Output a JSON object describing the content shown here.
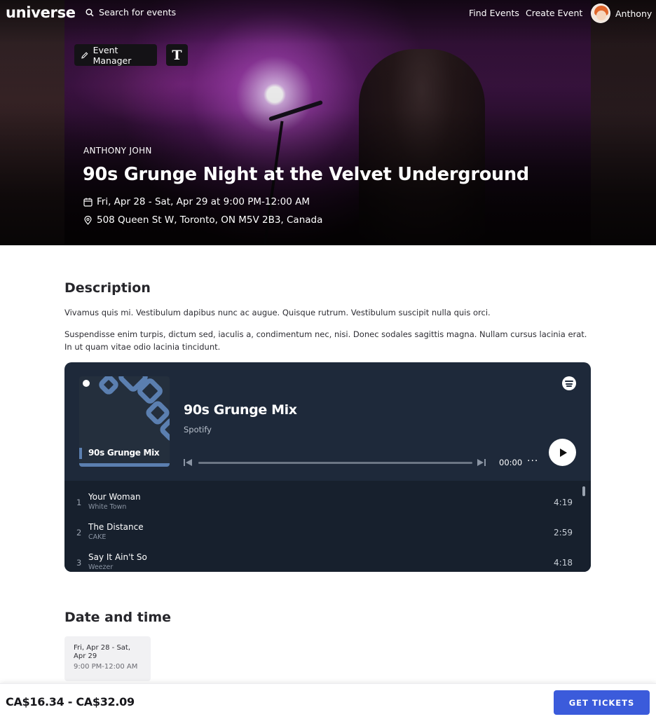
{
  "nav": {
    "logo": "universe",
    "search_label": "Search for events",
    "find_events": "Find Events",
    "create_event": "Create Event",
    "user_name": "Anthony"
  },
  "hero": {
    "event_manager_label": "Event Manager",
    "t_button_label": "T",
    "organizer": "ANTHONY JOHN",
    "title": "90s Grunge Night at the Velvet Underground",
    "date": "Fri, Apr 28 - Sat, Apr 29 at 9:00 PM-12:00 AM",
    "location": "508 Queen St W, Toronto, ON M5V 2B3, Canada"
  },
  "description": {
    "heading": "Description",
    "paragraphs": [
      "Vivamus quis mi. Vestibulum dapibus nunc ac augue. Quisque rutrum. Vestibulum suscipit nulla quis orci.",
      "Suspendisse enim turpis, dictum sed, iaculis a, condimentum nec, nisi. Donec sodales sagittis magna. Nullam cursus lacinia erat. In ut quam vitae odio lacinia tincidunt."
    ]
  },
  "spotify": {
    "cover_title": "90s Grunge Mix",
    "playlist_title": "90s Grunge Mix",
    "source": "Spotify",
    "time": "00:00",
    "more": "···",
    "tracks": [
      {
        "num": "1",
        "name": "Your Woman",
        "artist": "White Town",
        "duration": "4:19"
      },
      {
        "num": "2",
        "name": "The Distance",
        "artist": "CAKE",
        "duration": "2:59"
      },
      {
        "num": "3",
        "name": "Say It Ain't So",
        "artist": "Weezer",
        "duration": "4:18"
      }
    ]
  },
  "date_time": {
    "heading": "Date and time",
    "dates": "Fri, Apr 28 - Sat, Apr 29",
    "hours": "9:00 PM-12:00 AM"
  },
  "footer": {
    "price": "CA$16.34 - CA$32.09",
    "button": "GET TICKETS"
  },
  "colors": {
    "accent": "#3b5bdb",
    "embed_bg": "#1e293a"
  }
}
